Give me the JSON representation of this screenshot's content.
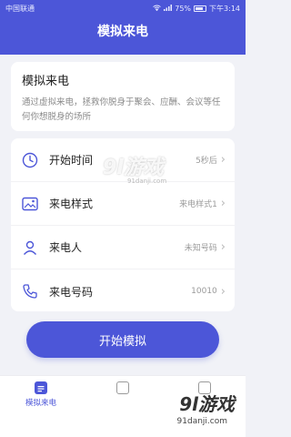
{
  "status_bar": {
    "carrier": "中国联通",
    "battery": "75%",
    "time": "下午3:14"
  },
  "header": {
    "title": "模拟来电"
  },
  "intro": {
    "title": "模拟来电",
    "description": "通过虚拟来电，拯救你脱身于聚会、应酬、会议等任何你想脱身的场所"
  },
  "settings": [
    {
      "label": "开始时间",
      "value": "5秒后",
      "icon": "clock-icon"
    },
    {
      "label": "来电样式",
      "value": "来电样式1",
      "icon": "image-icon"
    },
    {
      "label": "来电人",
      "value": "未知号码",
      "icon": "person-icon"
    },
    {
      "label": "来电号码",
      "value": "10010",
      "icon": "phone-icon"
    }
  ],
  "start_button": "开始模拟",
  "tabs": [
    {
      "label": "模拟来电",
      "active": true
    }
  ],
  "watermark": {
    "logo": "9l游戏",
    "site": "91danji.com",
    "center_logo": "9l游戏",
    "center_site": "91danji.com"
  },
  "colors": {
    "accent": "#4c56d8"
  }
}
